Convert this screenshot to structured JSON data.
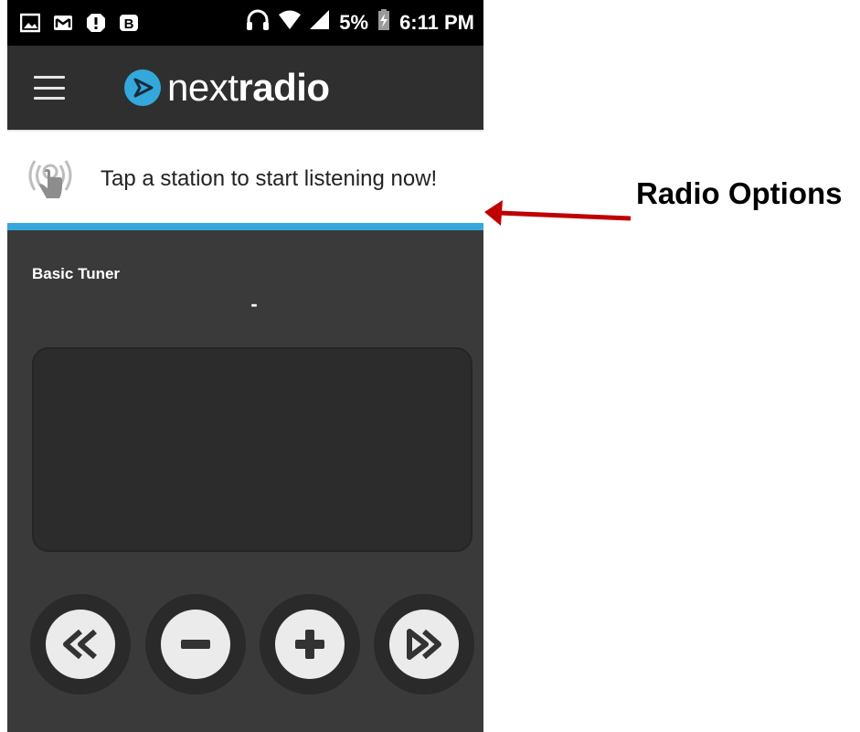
{
  "status_bar": {
    "battery": "5%",
    "time": "6:11 PM",
    "icons": [
      "image-icon",
      "gmail-icon",
      "notification-icon",
      "b-icon",
      "headset-icon",
      "wifi-icon",
      "signal-icon",
      "battery-charging-icon"
    ]
  },
  "app_bar": {
    "brand_prefix": "next",
    "brand_bold": "radio",
    "menu_icon": "hamburger-icon",
    "logo_icon": "nextradio-logo-icon"
  },
  "banner": {
    "message": "Tap a station to start listening now!",
    "icon": "tap-broadcast-icon",
    "accent_color": "#34a8db"
  },
  "tuner": {
    "title": "Basic Tuner",
    "frequency": "-"
  },
  "controls": [
    {
      "name": "seek-back-button",
      "icon": "rewind-icon"
    },
    {
      "name": "tune-down-button",
      "icon": "minus-icon"
    },
    {
      "name": "tune-up-button",
      "icon": "plus-icon"
    },
    {
      "name": "seek-forward-button",
      "icon": "fast-forward-icon"
    }
  ],
  "annotation": {
    "label": "Radio Options",
    "arrow_color": "#c00000"
  }
}
